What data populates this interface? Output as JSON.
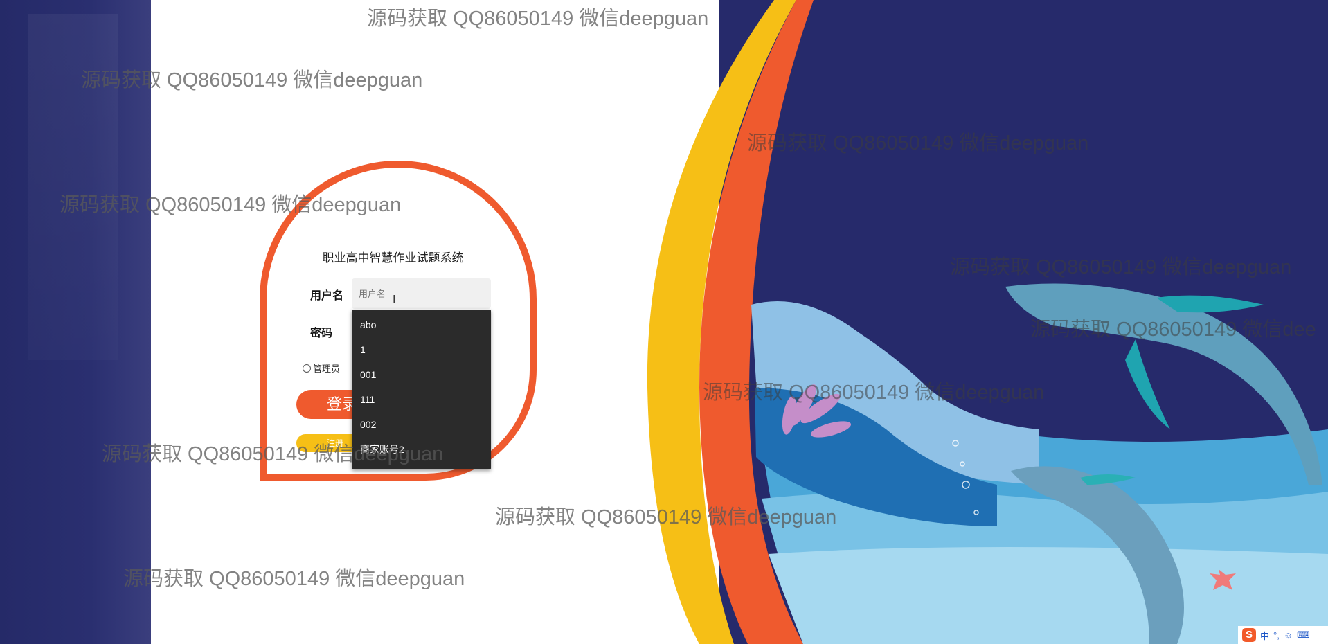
{
  "login": {
    "title": "职业高中智慧作业试题系统",
    "username_label": "用户名",
    "username_placeholder": "用户名",
    "password_label": "密码",
    "role_admin": "管理员",
    "login_button": "登录",
    "register_button": "注册"
  },
  "autocomplete": {
    "items": [
      "abo",
      "1",
      "001",
      "111",
      "002",
      "商家账号2"
    ]
  },
  "watermark": {
    "text": "源码获取 QQ86050149 微信deepguan",
    "partial_text": "源码获取 QQ86050149 微信dee"
  },
  "ime": {
    "logo": "S",
    "mode": "中",
    "punct": "°,"
  },
  "colors": {
    "accent": "#ef5a2e",
    "yellow": "#f6bf16",
    "navy": "#262a6b",
    "dropdown_bg": "#2b2b2b"
  }
}
